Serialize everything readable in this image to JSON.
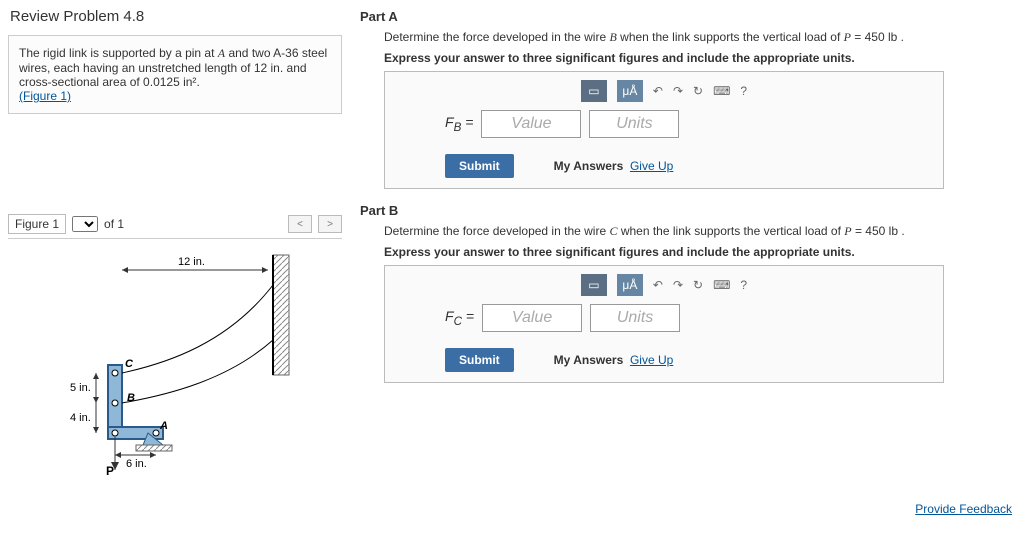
{
  "title": "Review Problem 4.8",
  "problem": {
    "text1": "The rigid link is supported by a pin at ",
    "varA": "A",
    "text2": " and two A-36 steel wires, each having an unstretched length of 12 ",
    "unitIn": "in.",
    "text3": " and cross-sectional area of 0.0125 ",
    "unitIn2": "in²",
    "text4": ".",
    "figlink": "(Figure 1)"
  },
  "figure": {
    "label": "Figure 1",
    "of": "of 1"
  },
  "diagram": {
    "lenTop": "12 in.",
    "lenLeft5": "5 in.",
    "lenLeft4": "4 in.",
    "lenBot": "6 in.",
    "C": "C",
    "B": "B",
    "A": "A",
    "P": "P"
  },
  "partA": {
    "title": "Part A",
    "q1": "Determine the force developed in the wire ",
    "wire": "B",
    "q2": " when the link supports the vertical load of ",
    "pvar": "P",
    "peq": " = 450 ",
    "punit": "lb",
    "q3": " .",
    "instr": "Express your answer to three significant figures and include the appropriate units.",
    "var": "F_B =",
    "valPH": "Value",
    "unitPH": "Units",
    "submit": "Submit",
    "myans": "My Answers",
    "giveup": "Give Up"
  },
  "partB": {
    "title": "Part B",
    "q1": "Determine the force developed in the wire ",
    "wire": "C",
    "q2": " when the link supports the vertical load of ",
    "pvar": "P",
    "peq": " = 450 ",
    "punit": "lb",
    "q3": " .",
    "instr": "Express your answer to three significant figures and include the appropriate units.",
    "var": "F_C =",
    "valPH": "Value",
    "unitPH": "Units",
    "submit": "Submit",
    "myans": "My Answers",
    "giveup": "Give Up"
  },
  "toolbar": {
    "chars": "μÅ",
    "help": "?"
  },
  "feedback": "Provide Feedback"
}
